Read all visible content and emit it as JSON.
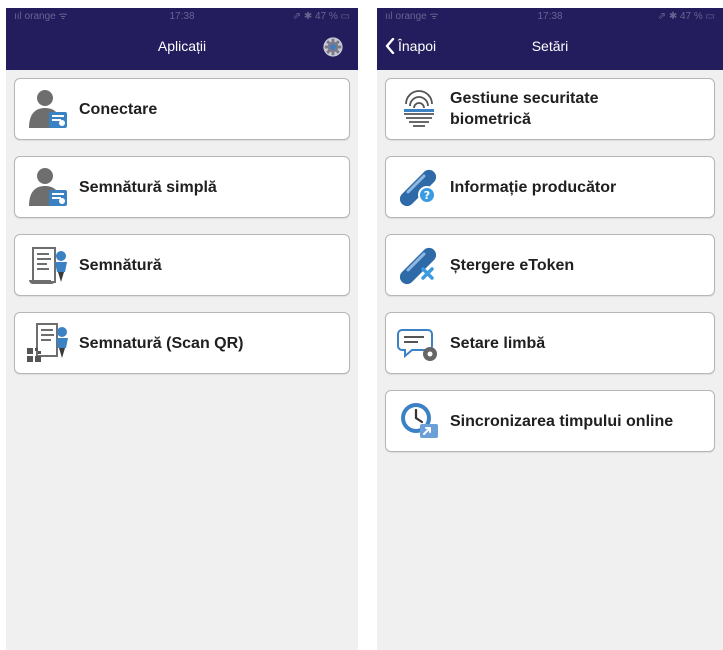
{
  "left_screen": {
    "status": {
      "carrier": "ııl orange ᯤ",
      "time": "17:38",
      "battery": "⇗ ✱ 47 % ▭"
    },
    "title": "Aplicații",
    "gear_icon": "gear-icon",
    "items": [
      {
        "label": "Conectare",
        "icon": "user-certificate-icon"
      },
      {
        "label": "Semnătură simplă",
        "icon": "user-certificate-icon"
      },
      {
        "label": "Semnătură",
        "icon": "document-signature-icon"
      },
      {
        "label": "Semnatură (Scan QR)",
        "icon": "qr-signature-icon"
      }
    ]
  },
  "right_screen": {
    "status": {
      "carrier": "ııl orange ᯤ",
      "time": "17:38",
      "battery": "⇗ ✱ 47 % ▭"
    },
    "back_label": "Înapoi",
    "title": "Setări",
    "items": [
      {
        "label_line1": "Gestiune securitate",
        "label_line2": "biometrică",
        "icon": "fingerprint-icon"
      },
      {
        "label": "Informație producător",
        "icon": "token-info-icon"
      },
      {
        "label": "Ștergere eToken",
        "icon": "token-delete-icon"
      },
      {
        "label": "Setare limbă",
        "icon": "language-settings-icon"
      },
      {
        "label": "Sincronizarea timpului online",
        "icon": "clock-sync-icon"
      }
    ]
  },
  "colors": {
    "navbar": "#231c5d",
    "background": "#f0f0f0",
    "card": "#ffffff",
    "accent_blue": "#3b82c4"
  }
}
